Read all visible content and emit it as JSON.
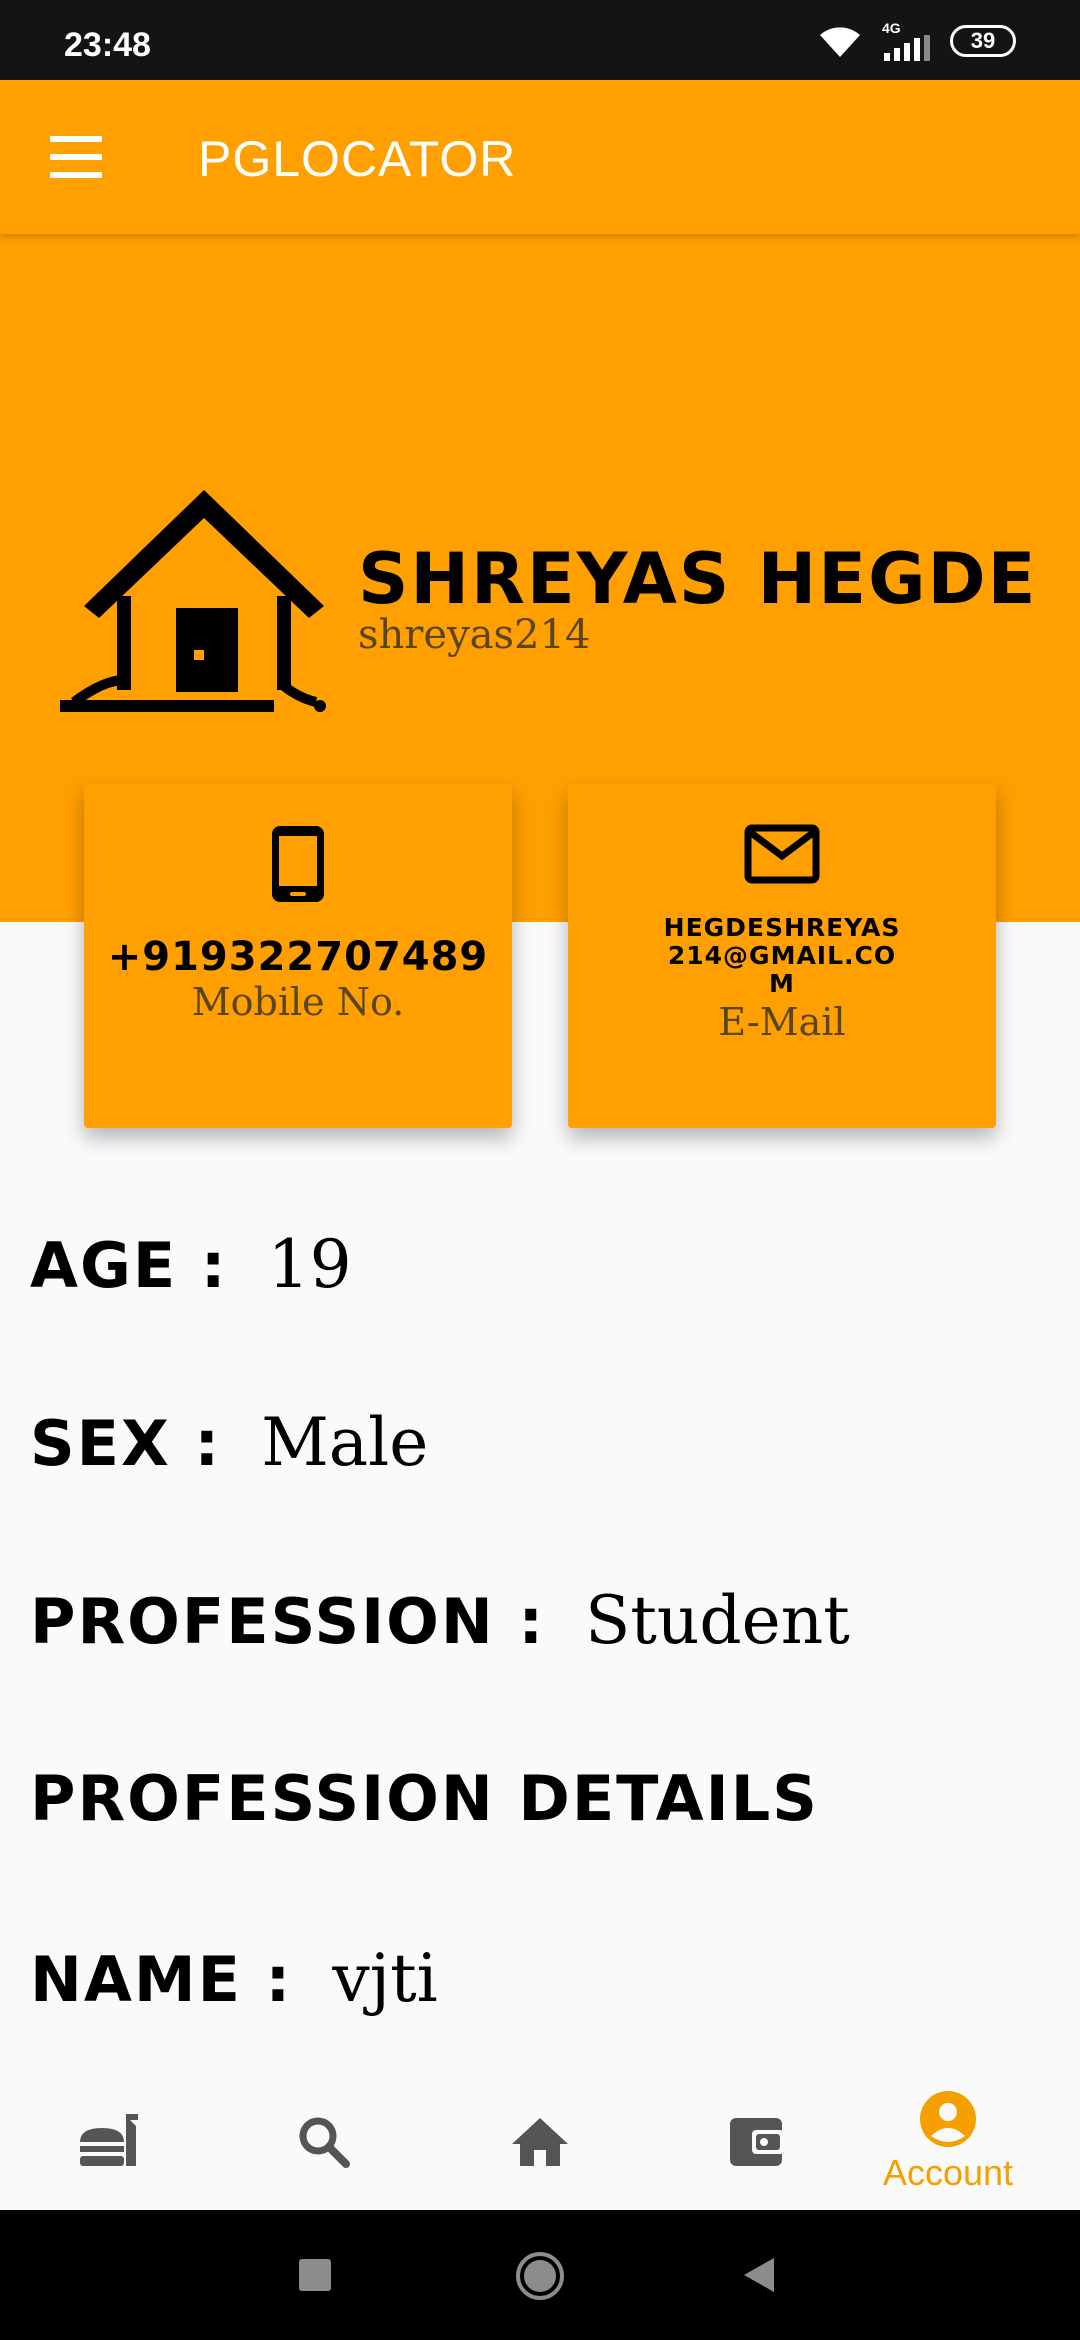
{
  "status_bar": {
    "time": "23:48",
    "network": "4G",
    "battery": "39"
  },
  "app_bar": {
    "title": "PGLOCATOR",
    "menu_icon": "hamburger-menu-icon"
  },
  "profile": {
    "name": "SHREYAS HEGDE",
    "username": "shreyas214",
    "logo_icon": "house-logo-icon"
  },
  "cards": {
    "phone": {
      "icon": "phone-icon",
      "value": "+919322707489",
      "label": "Mobile No."
    },
    "email": {
      "icon": "mail-icon",
      "value": "HEGDESHREYAS214@GMAIL.COM",
      "label": "E-Mail"
    }
  },
  "details": [
    {
      "key": "AGE :",
      "value": "19"
    },
    {
      "key": "SEX :",
      "value": "Male"
    },
    {
      "key": "PROFESSION :",
      "value": "Student"
    },
    {
      "key": "PROFESSION DETAILS",
      "value": ""
    },
    {
      "key": "NAME :",
      "value": "vjti"
    }
  ],
  "bottom_nav": {
    "items": [
      {
        "icon": "food-icon",
        "label": ""
      },
      {
        "icon": "search-icon",
        "label": ""
      },
      {
        "icon": "home-icon",
        "label": ""
      },
      {
        "icon": "wallet-icon",
        "label": ""
      },
      {
        "icon": "account-icon",
        "label": "Account",
        "active": true
      }
    ]
  },
  "colors": {
    "accent": "#ff9f00",
    "text_secondary": "#5a4522",
    "nav_inactive": "#555555",
    "nav_active": "#f5a000"
  }
}
